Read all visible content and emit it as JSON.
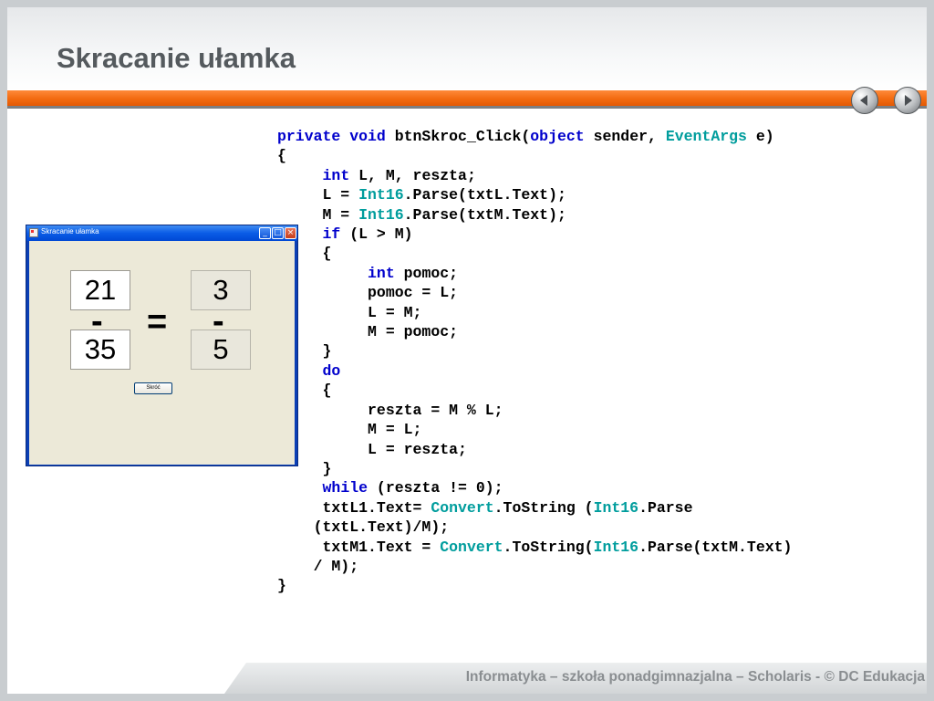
{
  "slide": {
    "title": "Skracanie ułamka",
    "footer": "Informatyka – szkoła ponadgimnazjalna – Scholaris - © DC Edukacja",
    "nav": {
      "prev_icon": "chevron-left-icon",
      "next_icon": "chevron-right-icon"
    }
  },
  "app": {
    "window_title": "Skracanie ułamka",
    "controls": {
      "minimize": "_",
      "maximize": "□",
      "close": "×"
    },
    "fraction_in": {
      "numerator": "21",
      "denominator": "35"
    },
    "fraction_out": {
      "numerator": "3",
      "denominator": "5"
    },
    "minus_sign": "-",
    "equals_sign": "=",
    "button_label": "Skróć"
  },
  "code": {
    "lines": [
      [
        {
          "t": "private",
          "c": "kw"
        },
        {
          "t": " "
        },
        {
          "t": "void",
          "c": "kw"
        },
        {
          "t": " btnSkroc_Click(",
          "c": "pl"
        },
        {
          "t": "object",
          "c": "kw"
        },
        {
          "t": " sender, ",
          "c": "pl"
        },
        {
          "t": "EventArgs",
          "c": "ty"
        },
        {
          "t": " e)",
          "c": "pl"
        }
      ],
      [
        {
          "t": "{",
          "c": "pl"
        }
      ],
      [
        {
          "t": "     "
        },
        {
          "t": "int",
          "c": "kw"
        },
        {
          "t": " L, M, reszta;",
          "c": "pl"
        }
      ],
      [
        {
          "t": "     L = ",
          "c": "pl"
        },
        {
          "t": "Int16",
          "c": "ty"
        },
        {
          "t": ".Parse(txtL.Text);",
          "c": "pl"
        }
      ],
      [
        {
          "t": "     M = ",
          "c": "pl"
        },
        {
          "t": "Int16",
          "c": "ty"
        },
        {
          "t": ".Parse(txtM.Text);",
          "c": "pl"
        }
      ],
      [
        {
          "t": "     "
        },
        {
          "t": "if",
          "c": "kw"
        },
        {
          "t": " (L > M)",
          "c": "pl"
        }
      ],
      [
        {
          "t": "     {",
          "c": "pl"
        }
      ],
      [
        {
          "t": "          "
        },
        {
          "t": "int",
          "c": "kw"
        },
        {
          "t": " pomoc;",
          "c": "pl"
        }
      ],
      [
        {
          "t": "          pomoc = L;",
          "c": "pl"
        }
      ],
      [
        {
          "t": "          L = M;",
          "c": "pl"
        }
      ],
      [
        {
          "t": "          M = pomoc;",
          "c": "pl"
        }
      ],
      [
        {
          "t": "     }",
          "c": "pl"
        }
      ],
      [
        {
          "t": "     "
        },
        {
          "t": "do",
          "c": "kw"
        }
      ],
      [
        {
          "t": "     {",
          "c": "pl"
        }
      ],
      [
        {
          "t": "          reszta = M % L;",
          "c": "pl"
        }
      ],
      [
        {
          "t": "          M = L;",
          "c": "pl"
        }
      ],
      [
        {
          "t": "          L = reszta;",
          "c": "pl"
        }
      ],
      [
        {
          "t": "     }",
          "c": "pl"
        }
      ],
      [
        {
          "t": "     "
        },
        {
          "t": "while",
          "c": "kw"
        },
        {
          "t": " (reszta != 0);",
          "c": "pl"
        }
      ],
      [
        {
          "t": "     txtL1.Text= ",
          "c": "pl"
        },
        {
          "t": "Convert",
          "c": "ty"
        },
        {
          "t": ".ToString (",
          "c": "pl"
        },
        {
          "t": "Int16",
          "c": "ty"
        },
        {
          "t": ".Parse",
          "c": "pl"
        }
      ],
      [
        {
          "t": "    (txtL.Text)/M);",
          "c": "pl"
        }
      ],
      [
        {
          "t": "     txtM1.Text = ",
          "c": "pl"
        },
        {
          "t": "Convert",
          "c": "ty"
        },
        {
          "t": ".ToString(",
          "c": "pl"
        },
        {
          "t": "Int16",
          "c": "ty"
        },
        {
          "t": ".Parse(txtM.Text)",
          "c": "pl"
        }
      ],
      [
        {
          "t": "    / M);",
          "c": "pl"
        }
      ],
      [
        {
          "t": "}",
          "c": "pl"
        }
      ]
    ]
  }
}
